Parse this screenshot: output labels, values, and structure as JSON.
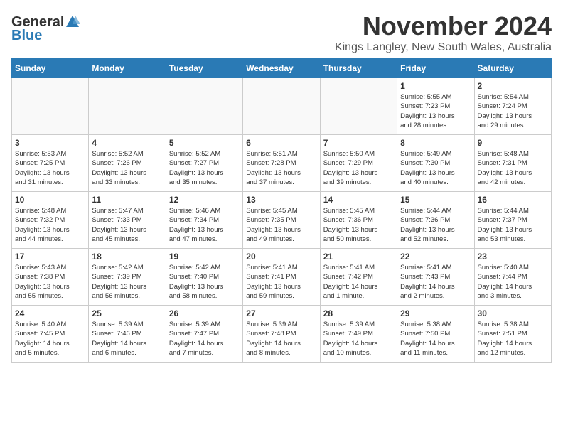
{
  "logo": {
    "general": "General",
    "blue": "Blue"
  },
  "header": {
    "month": "November 2024",
    "location": "Kings Langley, New South Wales, Australia"
  },
  "weekdays": [
    "Sunday",
    "Monday",
    "Tuesday",
    "Wednesday",
    "Thursday",
    "Friday",
    "Saturday"
  ],
  "weeks": [
    [
      {
        "day": "",
        "info": ""
      },
      {
        "day": "",
        "info": ""
      },
      {
        "day": "",
        "info": ""
      },
      {
        "day": "",
        "info": ""
      },
      {
        "day": "",
        "info": ""
      },
      {
        "day": "1",
        "info": "Sunrise: 5:55 AM\nSunset: 7:23 PM\nDaylight: 13 hours\nand 28 minutes."
      },
      {
        "day": "2",
        "info": "Sunrise: 5:54 AM\nSunset: 7:24 PM\nDaylight: 13 hours\nand 29 minutes."
      }
    ],
    [
      {
        "day": "3",
        "info": "Sunrise: 5:53 AM\nSunset: 7:25 PM\nDaylight: 13 hours\nand 31 minutes."
      },
      {
        "day": "4",
        "info": "Sunrise: 5:52 AM\nSunset: 7:26 PM\nDaylight: 13 hours\nand 33 minutes."
      },
      {
        "day": "5",
        "info": "Sunrise: 5:52 AM\nSunset: 7:27 PM\nDaylight: 13 hours\nand 35 minutes."
      },
      {
        "day": "6",
        "info": "Sunrise: 5:51 AM\nSunset: 7:28 PM\nDaylight: 13 hours\nand 37 minutes."
      },
      {
        "day": "7",
        "info": "Sunrise: 5:50 AM\nSunset: 7:29 PM\nDaylight: 13 hours\nand 39 minutes."
      },
      {
        "day": "8",
        "info": "Sunrise: 5:49 AM\nSunset: 7:30 PM\nDaylight: 13 hours\nand 40 minutes."
      },
      {
        "day": "9",
        "info": "Sunrise: 5:48 AM\nSunset: 7:31 PM\nDaylight: 13 hours\nand 42 minutes."
      }
    ],
    [
      {
        "day": "10",
        "info": "Sunrise: 5:48 AM\nSunset: 7:32 PM\nDaylight: 13 hours\nand 44 minutes."
      },
      {
        "day": "11",
        "info": "Sunrise: 5:47 AM\nSunset: 7:33 PM\nDaylight: 13 hours\nand 45 minutes."
      },
      {
        "day": "12",
        "info": "Sunrise: 5:46 AM\nSunset: 7:34 PM\nDaylight: 13 hours\nand 47 minutes."
      },
      {
        "day": "13",
        "info": "Sunrise: 5:45 AM\nSunset: 7:35 PM\nDaylight: 13 hours\nand 49 minutes."
      },
      {
        "day": "14",
        "info": "Sunrise: 5:45 AM\nSunset: 7:36 PM\nDaylight: 13 hours\nand 50 minutes."
      },
      {
        "day": "15",
        "info": "Sunrise: 5:44 AM\nSunset: 7:36 PM\nDaylight: 13 hours\nand 52 minutes."
      },
      {
        "day": "16",
        "info": "Sunrise: 5:44 AM\nSunset: 7:37 PM\nDaylight: 13 hours\nand 53 minutes."
      }
    ],
    [
      {
        "day": "17",
        "info": "Sunrise: 5:43 AM\nSunset: 7:38 PM\nDaylight: 13 hours\nand 55 minutes."
      },
      {
        "day": "18",
        "info": "Sunrise: 5:42 AM\nSunset: 7:39 PM\nDaylight: 13 hours\nand 56 minutes."
      },
      {
        "day": "19",
        "info": "Sunrise: 5:42 AM\nSunset: 7:40 PM\nDaylight: 13 hours\nand 58 minutes."
      },
      {
        "day": "20",
        "info": "Sunrise: 5:41 AM\nSunset: 7:41 PM\nDaylight: 13 hours\nand 59 minutes."
      },
      {
        "day": "21",
        "info": "Sunrise: 5:41 AM\nSunset: 7:42 PM\nDaylight: 14 hours\nand 1 minute."
      },
      {
        "day": "22",
        "info": "Sunrise: 5:41 AM\nSunset: 7:43 PM\nDaylight: 14 hours\nand 2 minutes."
      },
      {
        "day": "23",
        "info": "Sunrise: 5:40 AM\nSunset: 7:44 PM\nDaylight: 14 hours\nand 3 minutes."
      }
    ],
    [
      {
        "day": "24",
        "info": "Sunrise: 5:40 AM\nSunset: 7:45 PM\nDaylight: 14 hours\nand 5 minutes."
      },
      {
        "day": "25",
        "info": "Sunrise: 5:39 AM\nSunset: 7:46 PM\nDaylight: 14 hours\nand 6 minutes."
      },
      {
        "day": "26",
        "info": "Sunrise: 5:39 AM\nSunset: 7:47 PM\nDaylight: 14 hours\nand 7 minutes."
      },
      {
        "day": "27",
        "info": "Sunrise: 5:39 AM\nSunset: 7:48 PM\nDaylight: 14 hours\nand 8 minutes."
      },
      {
        "day": "28",
        "info": "Sunrise: 5:39 AM\nSunset: 7:49 PM\nDaylight: 14 hours\nand 10 minutes."
      },
      {
        "day": "29",
        "info": "Sunrise: 5:38 AM\nSunset: 7:50 PM\nDaylight: 14 hours\nand 11 minutes."
      },
      {
        "day": "30",
        "info": "Sunrise: 5:38 AM\nSunset: 7:51 PM\nDaylight: 14 hours\nand 12 minutes."
      }
    ]
  ]
}
